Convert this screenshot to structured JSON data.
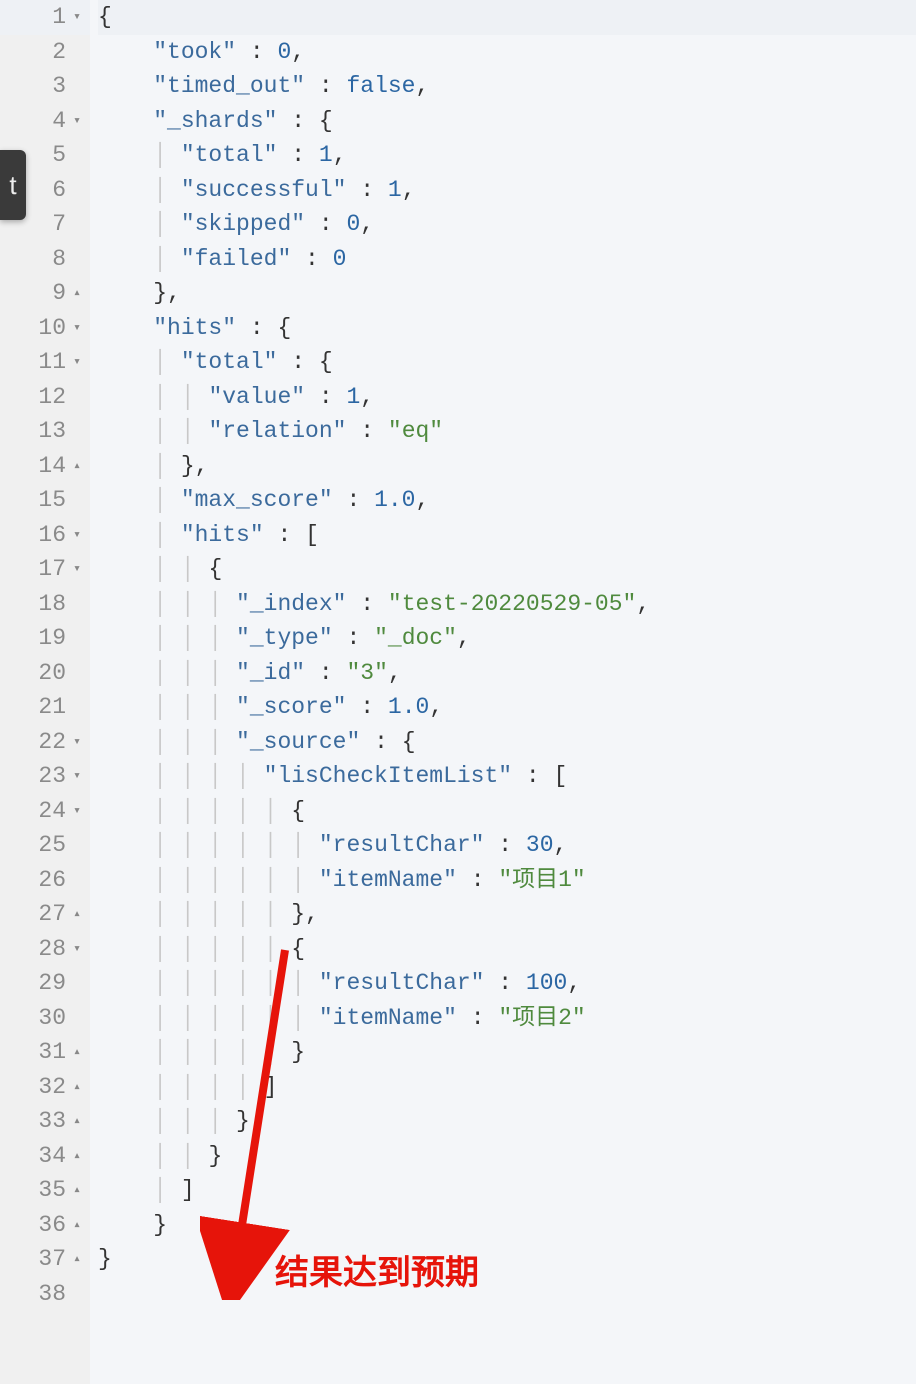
{
  "sidebar_fragment": "t",
  "annotation_text": "结果达到预期",
  "gutter": [
    {
      "n": "1",
      "fold": "▾"
    },
    {
      "n": "2",
      "fold": ""
    },
    {
      "n": "3",
      "fold": ""
    },
    {
      "n": "4",
      "fold": "▾"
    },
    {
      "n": "5",
      "fold": ""
    },
    {
      "n": "6",
      "fold": ""
    },
    {
      "n": "7",
      "fold": ""
    },
    {
      "n": "8",
      "fold": ""
    },
    {
      "n": "9",
      "fold": "▴"
    },
    {
      "n": "10",
      "fold": "▾"
    },
    {
      "n": "11",
      "fold": "▾"
    },
    {
      "n": "12",
      "fold": ""
    },
    {
      "n": "13",
      "fold": ""
    },
    {
      "n": "14",
      "fold": "▴"
    },
    {
      "n": "15",
      "fold": ""
    },
    {
      "n": "16",
      "fold": "▾"
    },
    {
      "n": "17",
      "fold": "▾"
    },
    {
      "n": "18",
      "fold": ""
    },
    {
      "n": "19",
      "fold": ""
    },
    {
      "n": "20",
      "fold": ""
    },
    {
      "n": "21",
      "fold": ""
    },
    {
      "n": "22",
      "fold": "▾"
    },
    {
      "n": "23",
      "fold": "▾"
    },
    {
      "n": "24",
      "fold": "▾"
    },
    {
      "n": "25",
      "fold": ""
    },
    {
      "n": "26",
      "fold": ""
    },
    {
      "n": "27",
      "fold": "▴"
    },
    {
      "n": "28",
      "fold": "▾"
    },
    {
      "n": "29",
      "fold": ""
    },
    {
      "n": "30",
      "fold": ""
    },
    {
      "n": "31",
      "fold": "▴"
    },
    {
      "n": "32",
      "fold": "▴"
    },
    {
      "n": "33",
      "fold": "▴"
    },
    {
      "n": "34",
      "fold": "▴"
    },
    {
      "n": "35",
      "fold": "▴"
    },
    {
      "n": "36",
      "fold": "▴"
    },
    {
      "n": "37",
      "fold": "▴"
    },
    {
      "n": "38",
      "fold": ""
    }
  ],
  "code": [
    [
      {
        "t": "{",
        "c": "punct"
      }
    ],
    [
      {
        "t": "    ",
        "c": ""
      },
      {
        "t": "\"took\"",
        "c": "key"
      },
      {
        "t": " : ",
        "c": "punct"
      },
      {
        "t": "0",
        "c": "num"
      },
      {
        "t": ",",
        "c": "punct"
      }
    ],
    [
      {
        "t": "    ",
        "c": ""
      },
      {
        "t": "\"timed_out\"",
        "c": "key"
      },
      {
        "t": " : ",
        "c": "punct"
      },
      {
        "t": "false",
        "c": "kw"
      },
      {
        "t": ",",
        "c": "punct"
      }
    ],
    [
      {
        "t": "    ",
        "c": ""
      },
      {
        "t": "\"_shards\"",
        "c": "key"
      },
      {
        "t": " : {",
        "c": "punct"
      }
    ],
    [
      {
        "t": "    ",
        "c": ""
      },
      {
        "t": "│ ",
        "c": "indent-guide"
      },
      {
        "t": "\"total\"",
        "c": "key"
      },
      {
        "t": " : ",
        "c": "punct"
      },
      {
        "t": "1",
        "c": "num"
      },
      {
        "t": ",",
        "c": "punct"
      }
    ],
    [
      {
        "t": "    ",
        "c": ""
      },
      {
        "t": "│ ",
        "c": "indent-guide"
      },
      {
        "t": "\"successful\"",
        "c": "key"
      },
      {
        "t": " : ",
        "c": "punct"
      },
      {
        "t": "1",
        "c": "num"
      },
      {
        "t": ",",
        "c": "punct"
      }
    ],
    [
      {
        "t": "    ",
        "c": ""
      },
      {
        "t": "│ ",
        "c": "indent-guide"
      },
      {
        "t": "\"skipped\"",
        "c": "key"
      },
      {
        "t": " : ",
        "c": "punct"
      },
      {
        "t": "0",
        "c": "num"
      },
      {
        "t": ",",
        "c": "punct"
      }
    ],
    [
      {
        "t": "    ",
        "c": ""
      },
      {
        "t": "│ ",
        "c": "indent-guide"
      },
      {
        "t": "\"failed\"",
        "c": "key"
      },
      {
        "t": " : ",
        "c": "punct"
      },
      {
        "t": "0",
        "c": "num"
      }
    ],
    [
      {
        "t": "    },",
        "c": "punct"
      }
    ],
    [
      {
        "t": "    ",
        "c": ""
      },
      {
        "t": "\"hits\"",
        "c": "key"
      },
      {
        "t": " : {",
        "c": "punct"
      }
    ],
    [
      {
        "t": "    ",
        "c": ""
      },
      {
        "t": "│ ",
        "c": "indent-guide"
      },
      {
        "t": "\"total\"",
        "c": "key"
      },
      {
        "t": " : {",
        "c": "punct"
      }
    ],
    [
      {
        "t": "    ",
        "c": ""
      },
      {
        "t": "│ │ ",
        "c": "indent-guide"
      },
      {
        "t": "\"value\"",
        "c": "key"
      },
      {
        "t": " : ",
        "c": "punct"
      },
      {
        "t": "1",
        "c": "num"
      },
      {
        "t": ",",
        "c": "punct"
      }
    ],
    [
      {
        "t": "    ",
        "c": ""
      },
      {
        "t": "│ │ ",
        "c": "indent-guide"
      },
      {
        "t": "\"relation\"",
        "c": "key"
      },
      {
        "t": " : ",
        "c": "punct"
      },
      {
        "t": "\"eq\"",
        "c": "str"
      }
    ],
    [
      {
        "t": "    ",
        "c": ""
      },
      {
        "t": "│ ",
        "c": "indent-guide"
      },
      {
        "t": "},",
        "c": "punct"
      }
    ],
    [
      {
        "t": "    ",
        "c": ""
      },
      {
        "t": "│ ",
        "c": "indent-guide"
      },
      {
        "t": "\"max_score\"",
        "c": "key"
      },
      {
        "t": " : ",
        "c": "punct"
      },
      {
        "t": "1.0",
        "c": "num"
      },
      {
        "t": ",",
        "c": "punct"
      }
    ],
    [
      {
        "t": "    ",
        "c": ""
      },
      {
        "t": "│ ",
        "c": "indent-guide"
      },
      {
        "t": "\"hits\"",
        "c": "key"
      },
      {
        "t": " : [",
        "c": "punct"
      }
    ],
    [
      {
        "t": "    ",
        "c": ""
      },
      {
        "t": "│ │ ",
        "c": "indent-guide"
      },
      {
        "t": "{",
        "c": "punct"
      }
    ],
    [
      {
        "t": "    ",
        "c": ""
      },
      {
        "t": "│ │ │ ",
        "c": "indent-guide"
      },
      {
        "t": "\"_index\"",
        "c": "key"
      },
      {
        "t": " : ",
        "c": "punct"
      },
      {
        "t": "\"test-20220529-05\"",
        "c": "str"
      },
      {
        "t": ",",
        "c": "punct"
      }
    ],
    [
      {
        "t": "    ",
        "c": ""
      },
      {
        "t": "│ │ │ ",
        "c": "indent-guide"
      },
      {
        "t": "\"_type\"",
        "c": "key"
      },
      {
        "t": " : ",
        "c": "punct"
      },
      {
        "t": "\"_doc\"",
        "c": "str"
      },
      {
        "t": ",",
        "c": "punct"
      }
    ],
    [
      {
        "t": "    ",
        "c": ""
      },
      {
        "t": "│ │ │ ",
        "c": "indent-guide"
      },
      {
        "t": "\"_id\"",
        "c": "key"
      },
      {
        "t": " : ",
        "c": "punct"
      },
      {
        "t": "\"3\"",
        "c": "str"
      },
      {
        "t": ",",
        "c": "punct"
      }
    ],
    [
      {
        "t": "    ",
        "c": ""
      },
      {
        "t": "│ │ │ ",
        "c": "indent-guide"
      },
      {
        "t": "\"_score\"",
        "c": "key"
      },
      {
        "t": " : ",
        "c": "punct"
      },
      {
        "t": "1.0",
        "c": "num"
      },
      {
        "t": ",",
        "c": "punct"
      }
    ],
    [
      {
        "t": "    ",
        "c": ""
      },
      {
        "t": "│ │ │ ",
        "c": "indent-guide"
      },
      {
        "t": "\"_source\"",
        "c": "key"
      },
      {
        "t": " : {",
        "c": "punct"
      }
    ],
    [
      {
        "t": "    ",
        "c": ""
      },
      {
        "t": "│ │ │ │ ",
        "c": "indent-guide"
      },
      {
        "t": "\"lisCheckItemList\"",
        "c": "key"
      },
      {
        "t": " : [",
        "c": "punct"
      }
    ],
    [
      {
        "t": "    ",
        "c": ""
      },
      {
        "t": "│ │ │ │ │ ",
        "c": "indent-guide"
      },
      {
        "t": "{",
        "c": "punct"
      }
    ],
    [
      {
        "t": "    ",
        "c": ""
      },
      {
        "t": "│ │ │ │ │ │ ",
        "c": "indent-guide"
      },
      {
        "t": "\"resultChar\"",
        "c": "key"
      },
      {
        "t": " : ",
        "c": "punct"
      },
      {
        "t": "30",
        "c": "num"
      },
      {
        "t": ",",
        "c": "punct"
      }
    ],
    [
      {
        "t": "    ",
        "c": ""
      },
      {
        "t": "│ │ │ │ │ │ ",
        "c": "indent-guide"
      },
      {
        "t": "\"itemName\"",
        "c": "key"
      },
      {
        "t": " : ",
        "c": "punct"
      },
      {
        "t": "\"项目1\"",
        "c": "str"
      }
    ],
    [
      {
        "t": "    ",
        "c": ""
      },
      {
        "t": "│ │ │ │ │ ",
        "c": "indent-guide"
      },
      {
        "t": "},",
        "c": "punct"
      }
    ],
    [
      {
        "t": "    ",
        "c": ""
      },
      {
        "t": "│ │ │ │ │ ",
        "c": "indent-guide"
      },
      {
        "t": "{",
        "c": "punct"
      }
    ],
    [
      {
        "t": "    ",
        "c": ""
      },
      {
        "t": "│ │ │ │ │ │ ",
        "c": "indent-guide"
      },
      {
        "t": "\"resultChar\"",
        "c": "key"
      },
      {
        "t": " : ",
        "c": "punct"
      },
      {
        "t": "100",
        "c": "num"
      },
      {
        "t": ",",
        "c": "punct"
      }
    ],
    [
      {
        "t": "    ",
        "c": ""
      },
      {
        "t": "│ │ │ │ │ │ ",
        "c": "indent-guide"
      },
      {
        "t": "\"itemName\"",
        "c": "key"
      },
      {
        "t": " : ",
        "c": "punct"
      },
      {
        "t": "\"项目2\"",
        "c": "str"
      }
    ],
    [
      {
        "t": "    ",
        "c": ""
      },
      {
        "t": "│ │ │ │ │ ",
        "c": "indent-guide"
      },
      {
        "t": "}",
        "c": "punct"
      }
    ],
    [
      {
        "t": "    ",
        "c": ""
      },
      {
        "t": "│ │ │ │ ",
        "c": "indent-guide"
      },
      {
        "t": "]",
        "c": "punct"
      }
    ],
    [
      {
        "t": "    ",
        "c": ""
      },
      {
        "t": "│ │ │ ",
        "c": "indent-guide"
      },
      {
        "t": "}",
        "c": "punct"
      }
    ],
    [
      {
        "t": "    ",
        "c": ""
      },
      {
        "t": "│ │ ",
        "c": "indent-guide"
      },
      {
        "t": "}",
        "c": "punct"
      }
    ],
    [
      {
        "t": "    ",
        "c": ""
      },
      {
        "t": "│ ",
        "c": "indent-guide"
      },
      {
        "t": "]",
        "c": "punct"
      }
    ],
    [
      {
        "t": "    }",
        "c": "punct"
      }
    ],
    [
      {
        "t": "}",
        "c": "punct"
      }
    ],
    [
      {
        "t": "",
        "c": ""
      }
    ]
  ]
}
